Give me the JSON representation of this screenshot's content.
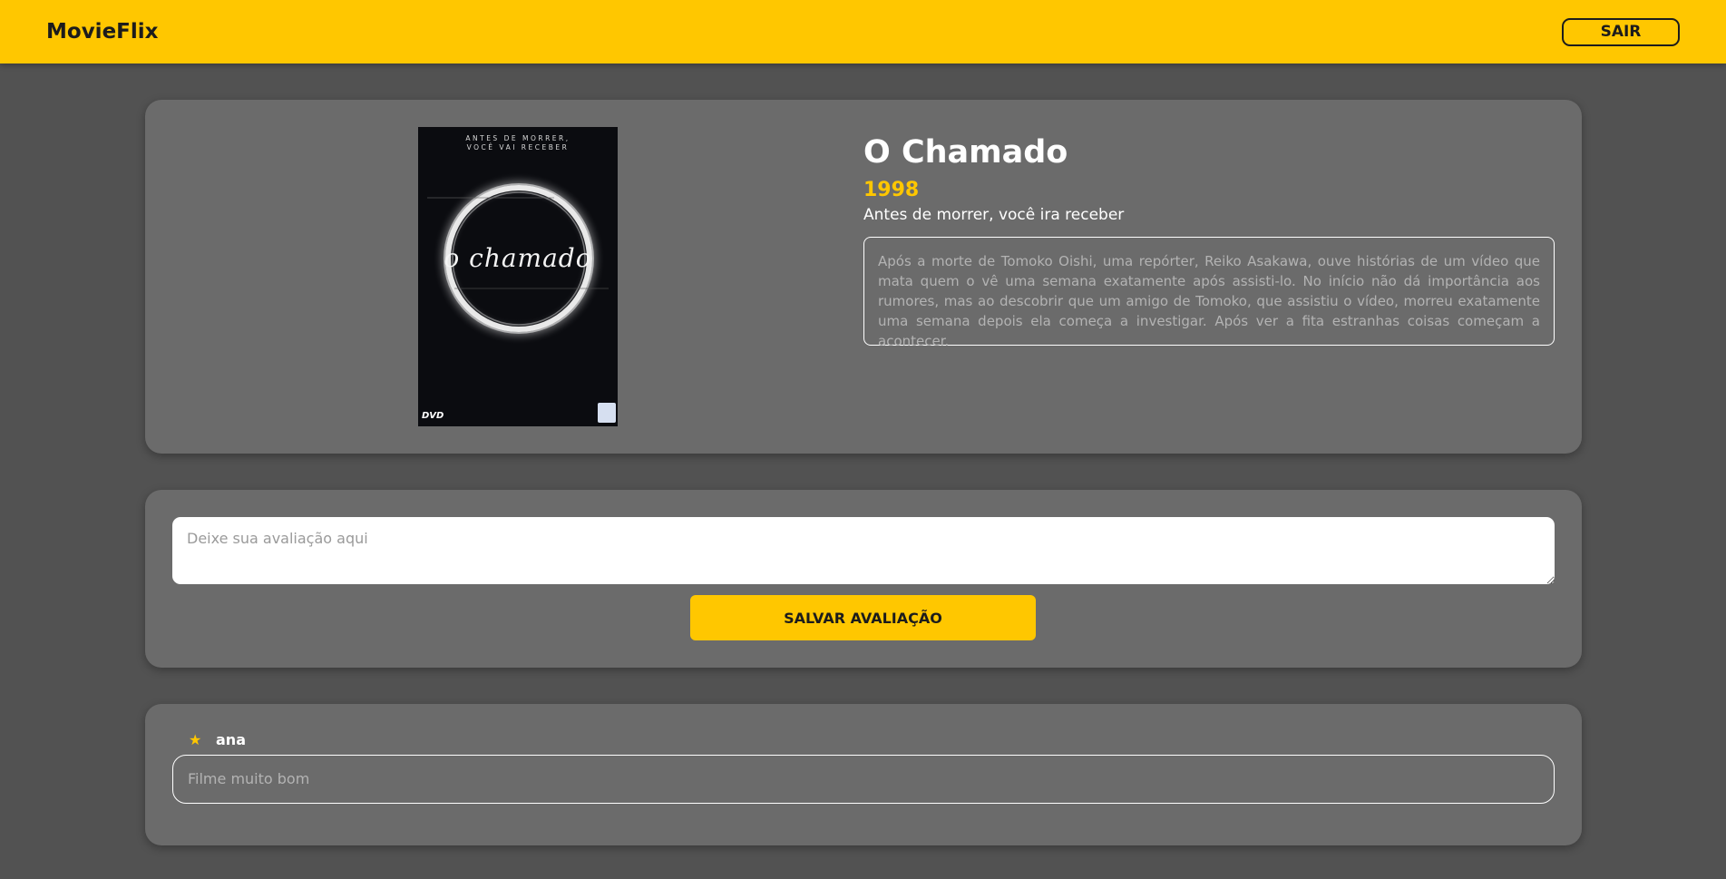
{
  "navbar": {
    "brand": "MovieFlix",
    "logout_label": "SAIR",
    "bg_color": "#ffc700"
  },
  "movie": {
    "poster": {
      "tagline_line1": "ANTES DE MORRER,",
      "tagline_line2": "VOCÊ VAI RECEBER",
      "title_art": "o chamado",
      "dvd_mark": "DVD"
    },
    "title": "O Chamado",
    "year": "1998",
    "subtitle": "Antes de morrer, você ira receber",
    "synopsis": "Após a morte de Tomoko Oishi, uma repórter, Reiko Asakawa, ouve histórias de um vídeo que mata quem o vê uma semana exatamente após assisti-lo. No início não dá importância aos rumores, mas ao descobrir que um amigo de Tomoko, que assistiu o vídeo, morreu exatamente uma semana depois ela começa a investigar. Após ver a fita estranhas coisas começam a acontecer."
  },
  "review_form": {
    "placeholder": "Deixe sua avaliação aqui",
    "save_label": "SALVAR AVALIAÇÃO"
  },
  "reviews": [
    {
      "icon": "star-icon",
      "user": "ana",
      "text": "Filme muito bom"
    }
  ]
}
